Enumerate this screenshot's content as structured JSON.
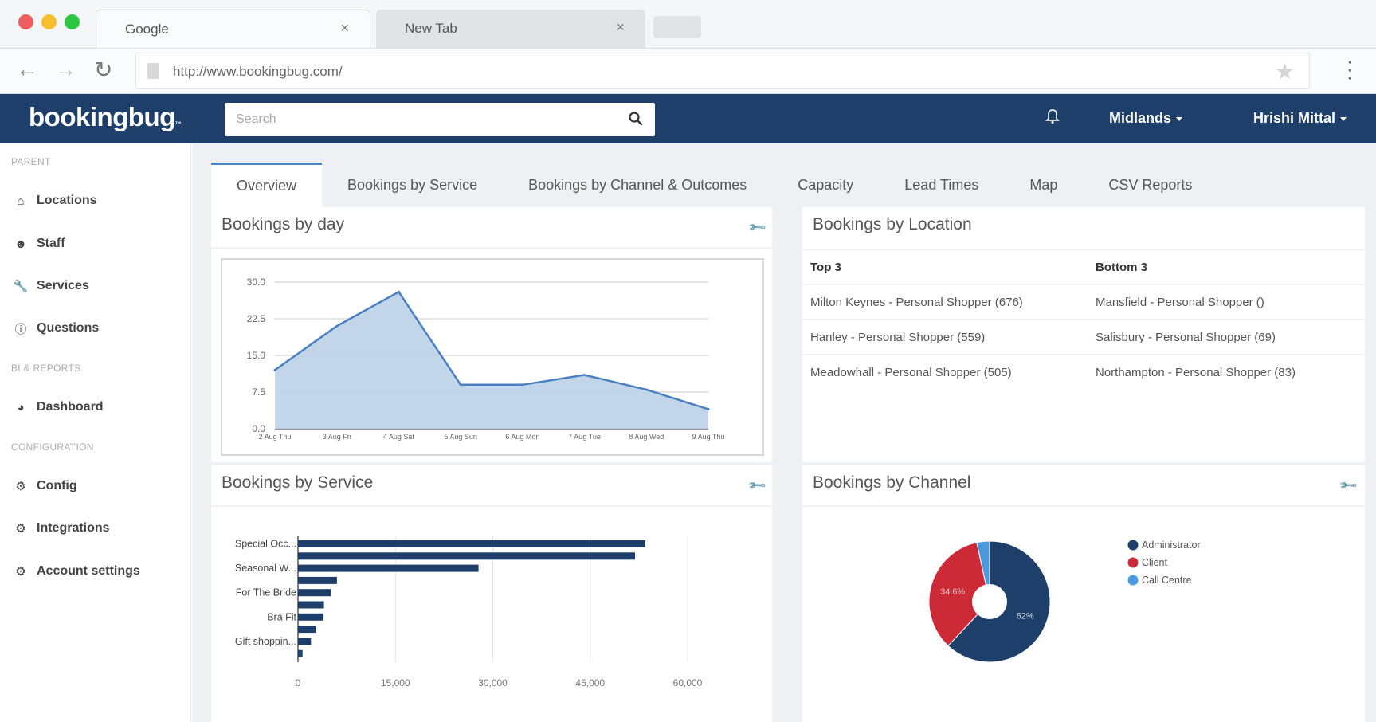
{
  "browser": {
    "tabs": [
      {
        "title": "Google",
        "close": "×"
      },
      {
        "title": "New Tab",
        "close": "×"
      }
    ],
    "url": "http://www.bookingbug.com/"
  },
  "header": {
    "logo": "bookingbug",
    "logo_mark": "™",
    "search_placeholder": "Search",
    "region": "Midlands",
    "user": "Hrishi Mittal"
  },
  "sidebar": {
    "sections": [
      {
        "heading": "PARENT"
      },
      {
        "heading": "BI & REPORTS"
      },
      {
        "heading": "CONFIGURATION"
      }
    ],
    "items": [
      {
        "label": "Locations",
        "icon": "home-icon"
      },
      {
        "label": "Staff",
        "icon": "users-icon"
      },
      {
        "label": "Services",
        "icon": "wrench-icon"
      },
      {
        "label": "Questions",
        "icon": "question-circle-icon"
      },
      {
        "label": "Dashboard",
        "icon": "pie-chart-icon"
      },
      {
        "label": "Config",
        "icon": "cogs-icon"
      },
      {
        "label": "Integrations",
        "icon": "cogs-icon"
      },
      {
        "label": "Account settings",
        "icon": "cogs-icon"
      }
    ]
  },
  "tabs": [
    {
      "label": "Overview",
      "active": true
    },
    {
      "label": "Bookings by Service"
    },
    {
      "label": "Bookings by Channel & Outcomes"
    },
    {
      "label": "Capacity"
    },
    {
      "label": "Lead Times"
    },
    {
      "label": "Map"
    },
    {
      "label": "CSV Reports"
    }
  ],
  "panels": {
    "by_day": {
      "title": "Bookings by day"
    },
    "by_location": {
      "title": "Bookings by Location",
      "headers": [
        "Top 3",
        "Bottom 3"
      ],
      "rows": [
        [
          "Milton Keynes - Personal Shopper (676)",
          "Mansfield - Personal Shopper ()"
        ],
        [
          "Hanley - Personal Shopper (559)",
          "Salisbury - Personal Shopper (69)"
        ],
        [
          "Meadowhall - Personal Shopper (505)",
          "Northampton - Personal Shopper (83)"
        ]
      ]
    },
    "by_service": {
      "title": "Bookings by Service"
    },
    "by_channel": {
      "title": "Bookings by Channel"
    }
  },
  "colors": {
    "brand": "#1d3f6a",
    "line": "#4a7fc1",
    "area": "#c0d4e8",
    "bar": "#1d3f6a",
    "admin": "#1d3f6a",
    "client": "#cc2a36",
    "call_centre": "#4a9ae0"
  },
  "chart_data": [
    {
      "type": "area",
      "title": "Bookings by day",
      "categories": [
        "2 Aug Thu",
        "3 Aug Fri",
        "4 Aug Sat",
        "5 Aug Sun",
        "6 Aug Mon",
        "7 Aug Tue",
        "8 Aug Wed",
        "9 Aug Thu"
      ],
      "values": [
        12,
        21,
        28,
        9,
        9,
        11,
        8,
        4
      ],
      "yticks": [
        "0.0",
        "7.5",
        "15.0",
        "22.5",
        "30.0"
      ],
      "ylim": [
        0,
        30
      ],
      "grid": true
    },
    {
      "type": "bar",
      "orientation": "horizontal",
      "title": "Bookings by Service",
      "categories": [
        "Special Occ...",
        "",
        "Seasonal W...",
        "",
        "For The Bride",
        "",
        "Bra Fit",
        "",
        "Gift shoppin...",
        ""
      ],
      "values": [
        53500,
        51900,
        27800,
        6000,
        5100,
        4000,
        3900,
        2700,
        2000,
        700
      ],
      "xticks": [
        "0",
        "15,000",
        "30,000",
        "45,000",
        "60,000"
      ],
      "xlim": [
        0,
        60000
      ],
      "grid": true
    },
    {
      "type": "pie",
      "donut": true,
      "title": "Bookings by Channel",
      "labels": [
        "Administrator",
        "Client",
        "Call Centre"
      ],
      "values": [
        62,
        34.6,
        3.4
      ],
      "value_labels": [
        "62%",
        "34.6%",
        ""
      ],
      "legend": "right"
    }
  ]
}
